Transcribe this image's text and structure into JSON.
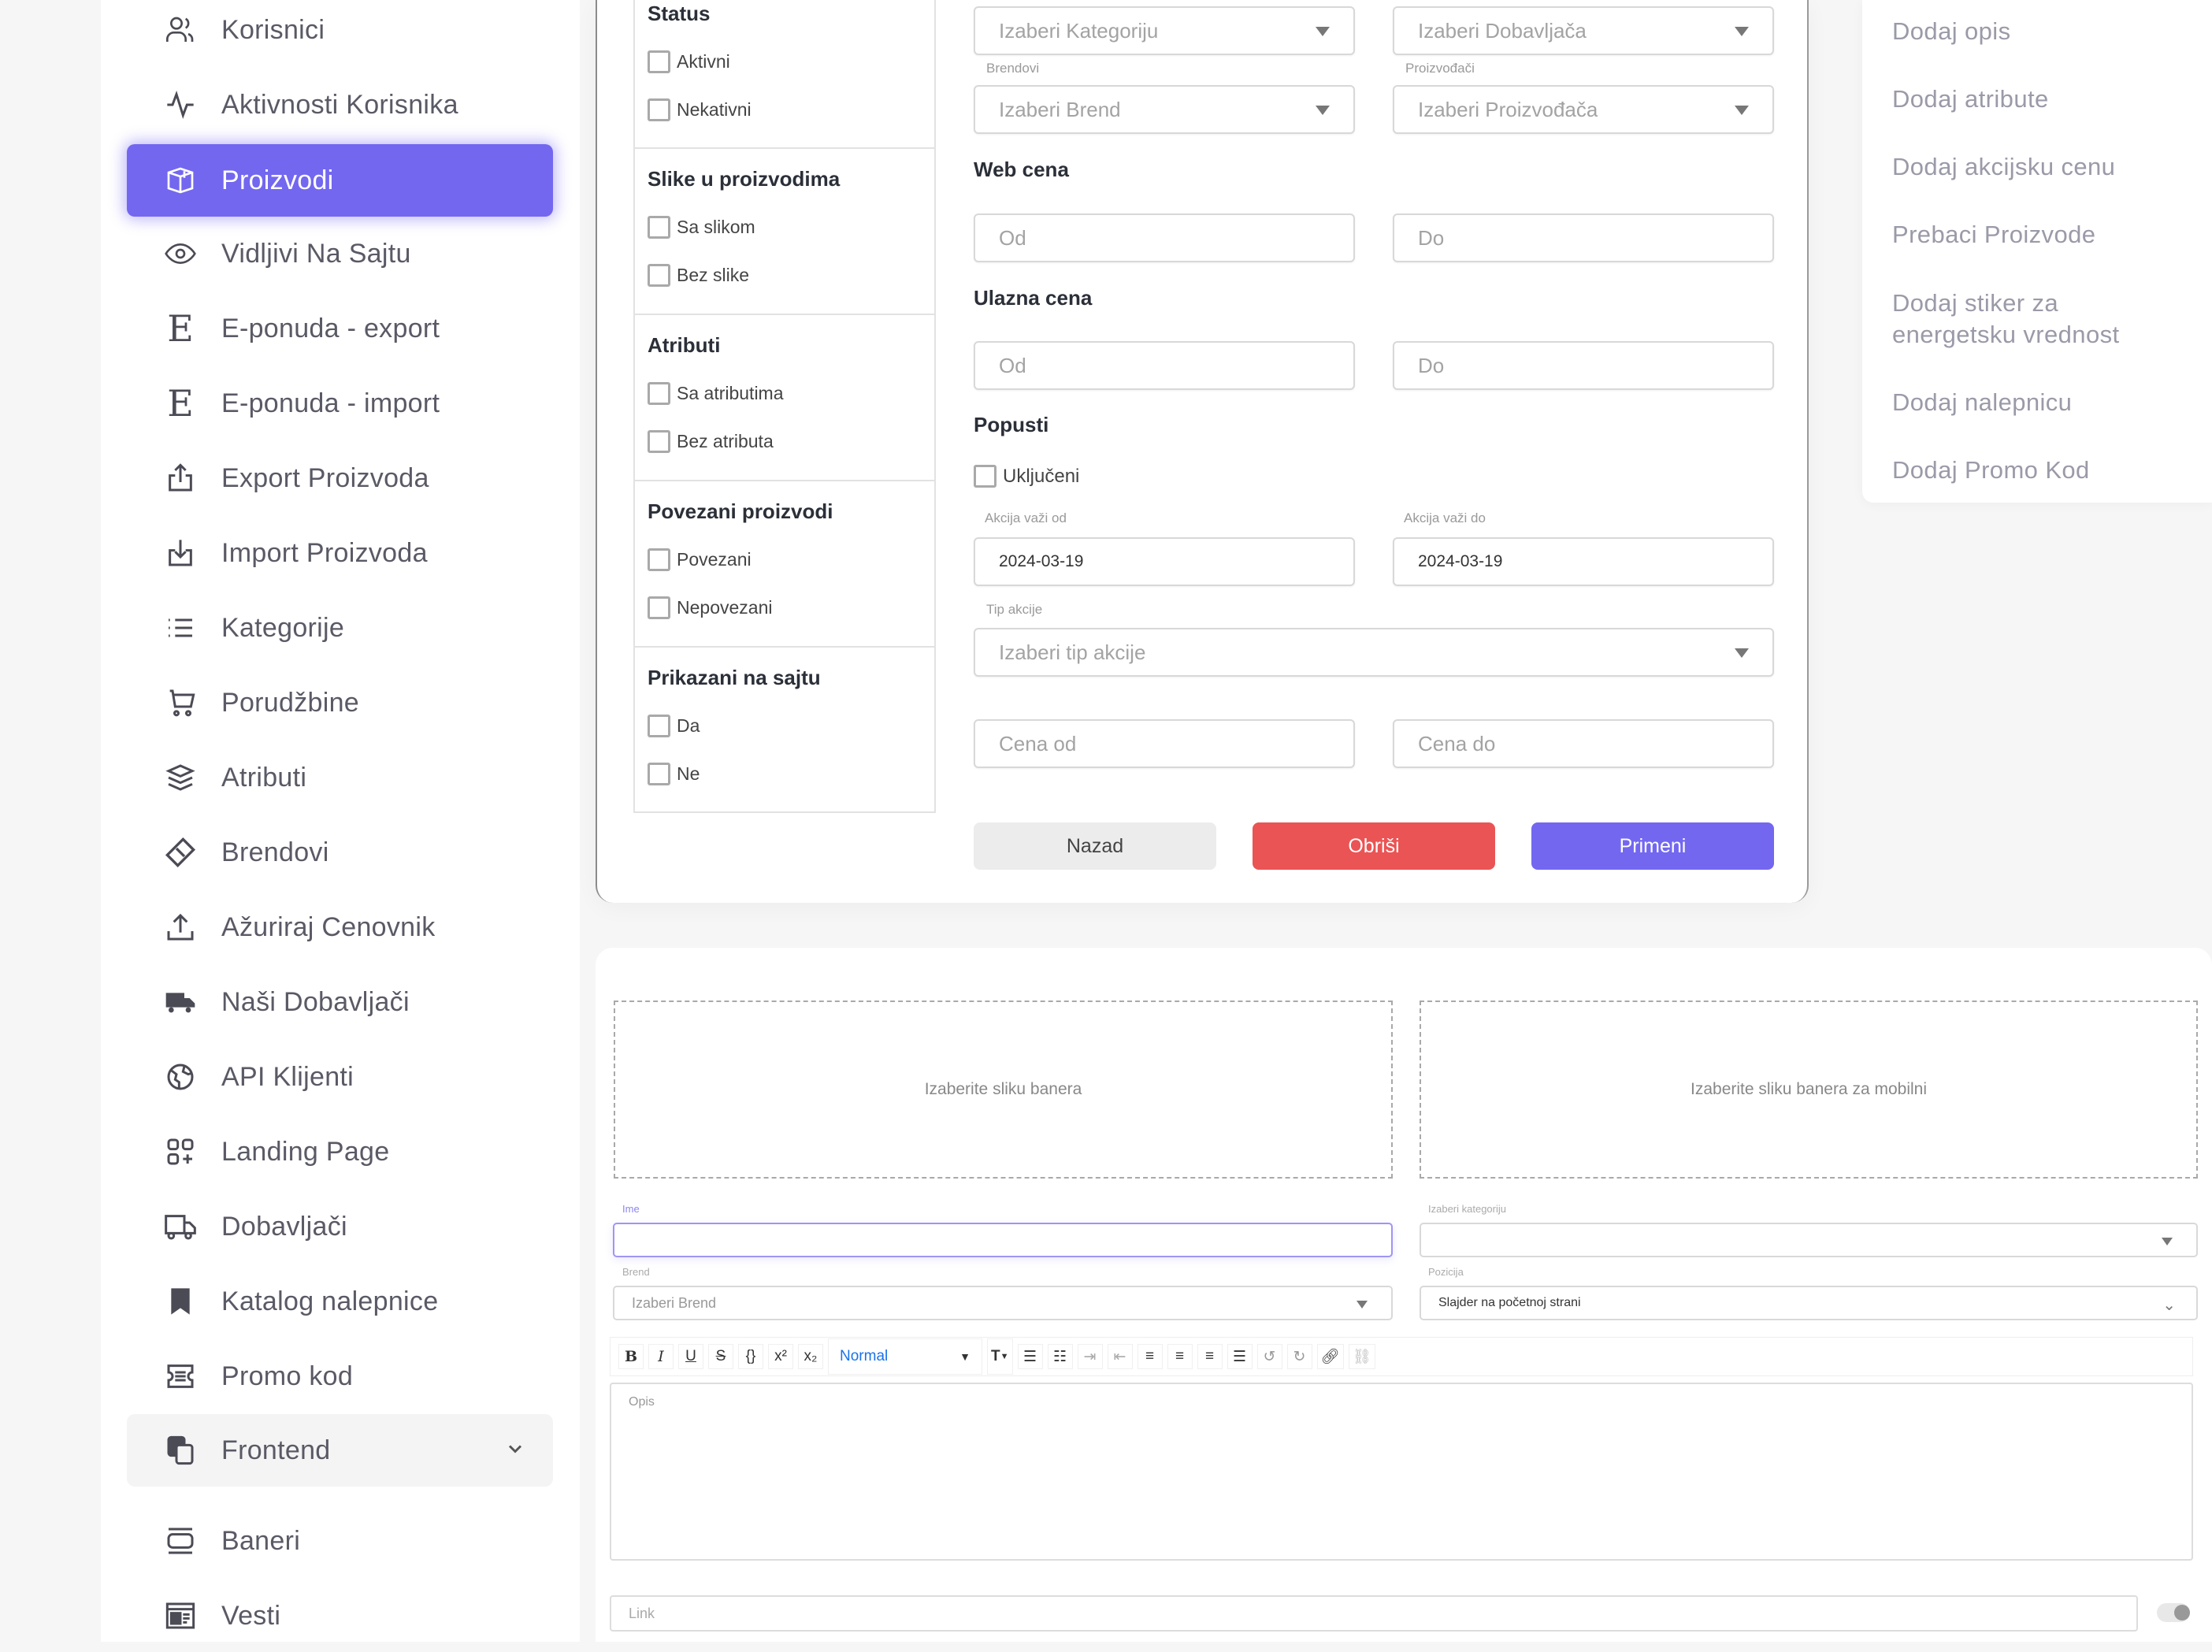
{
  "sidebar": {
    "items": [
      {
        "label": "Korisnici",
        "icon": "users-icon"
      },
      {
        "label": "Aktivnosti Korisnika",
        "icon": "activity-icon"
      },
      {
        "label": "Proizvodi",
        "icon": "box-icon",
        "active": true
      },
      {
        "label": "Vidljivi Na Sajtu",
        "icon": "eye-icon"
      },
      {
        "label": "E-ponuda - export",
        "icon": "e-letter-icon"
      },
      {
        "label": "E-ponuda - import",
        "icon": "e-letter-icon"
      },
      {
        "label": "Export Proizvoda",
        "icon": "upload-box-icon"
      },
      {
        "label": "Import Proizvoda",
        "icon": "download-box-icon"
      },
      {
        "label": "Kategorije",
        "icon": "list-icon"
      },
      {
        "label": "Porudžbine",
        "icon": "cart-icon"
      },
      {
        "label": "Atributi",
        "icon": "layers-icon"
      },
      {
        "label": "Brendovi",
        "icon": "ticket-icon"
      },
      {
        "label": "Ažuriraj Cenovnik",
        "icon": "upload-icon"
      },
      {
        "label": "Naši Dobavljači",
        "icon": "truck-filled-icon"
      },
      {
        "label": "API Klijenti",
        "icon": "globe-icon"
      },
      {
        "label": "Landing Page",
        "icon": "apps-add-icon"
      },
      {
        "label": "Dobavljači",
        "icon": "truck-icon"
      },
      {
        "label": "Katalog nalepnice",
        "icon": "bookmark-icon"
      },
      {
        "label": "Promo kod",
        "icon": "coupon-icon"
      }
    ],
    "group": {
      "label": "Frontend",
      "icon": "copy-icon",
      "expanded": true
    },
    "sub_items": [
      {
        "label": "Baneri",
        "icon": "banner-icon"
      },
      {
        "label": "Vesti",
        "icon": "news-icon"
      }
    ]
  },
  "filters": {
    "checkbox_groups": [
      {
        "title": "Status",
        "options": [
          "Aktivni",
          "Nekativni"
        ]
      },
      {
        "title": "Slike u proizvodima",
        "options": [
          "Sa slikom",
          "Bez slike"
        ]
      },
      {
        "title": "Atributi",
        "options": [
          "Sa atributima",
          "Bez atributa"
        ]
      },
      {
        "title": "Povezani proizvodi",
        "options": [
          "Povezani",
          "Nepovezani"
        ]
      },
      {
        "title": "Prikazani na sajtu",
        "options": [
          "Da",
          "Ne"
        ]
      }
    ],
    "category_select": {
      "placeholder": "Izaberi Kategoriju"
    },
    "supplier_select": {
      "placeholder": "Izaberi Dobavljača"
    },
    "brand_label": "Brendovi",
    "brand_select": {
      "placeholder": "Izaberi Brend"
    },
    "manufacturer_label": "Proizvođači",
    "manufacturer_select": {
      "placeholder": "Izaberi Proizvođača"
    },
    "web_price": {
      "title": "Web cena",
      "from_placeholder": "Od",
      "to_placeholder": "Do"
    },
    "input_price": {
      "title": "Ulazna cena",
      "from_placeholder": "Od",
      "to_placeholder": "Do"
    },
    "discounts": {
      "title": "Popusti",
      "included_label": "Uključeni",
      "valid_from_label": "Akcija važi od",
      "valid_from": "2024-03-19",
      "valid_to_label": "Akcija važi do",
      "valid_to": "2024-03-19",
      "type_label": "Tip akcije",
      "type_placeholder": "Izaberi tip akcije",
      "price_from_placeholder": "Cena od",
      "price_to_placeholder": "Cena do"
    },
    "buttons": {
      "back": "Nazad",
      "delete": "Obriši",
      "apply": "Primeni"
    }
  },
  "action_menu": {
    "items": [
      "Dodaj opis",
      "Dodaj atribute",
      "Dodaj akcijsku cenu",
      "Prebaci Proizvode",
      "Dodaj stiker za energetsku vrednost",
      "Dodaj nalepnicu",
      "Dodaj Promo Kod"
    ]
  },
  "banner_form": {
    "desktop_drop": "Izaberite sliku banera",
    "mobile_drop": "Izaberite sliku banera za mobilni",
    "name_label": "Ime",
    "name_value": "",
    "category_label": "Izaberi kategoriju",
    "category_value": "",
    "brand_label": "Brend",
    "brand_placeholder": "Izaberi Brend",
    "position_label": "Pozicija",
    "position_value": "Slajder na početnoj strani",
    "editor": {
      "format_select": "Normal",
      "tools": [
        "bold",
        "italic",
        "underline",
        "strike",
        "code",
        "superscript",
        "subscript",
        "font-size",
        "bullet-list",
        "ordered-list",
        "indent",
        "outdent",
        "align-left",
        "align-center",
        "align-right",
        "justify",
        "undo",
        "redo",
        "link",
        "unlink"
      ],
      "placeholder": "Opis"
    },
    "link_placeholder": "Link",
    "link_toggle_on": false
  },
  "colors": {
    "primary": "#7367f0",
    "danger": "#ea5455",
    "neutral_button": "#ececec"
  }
}
